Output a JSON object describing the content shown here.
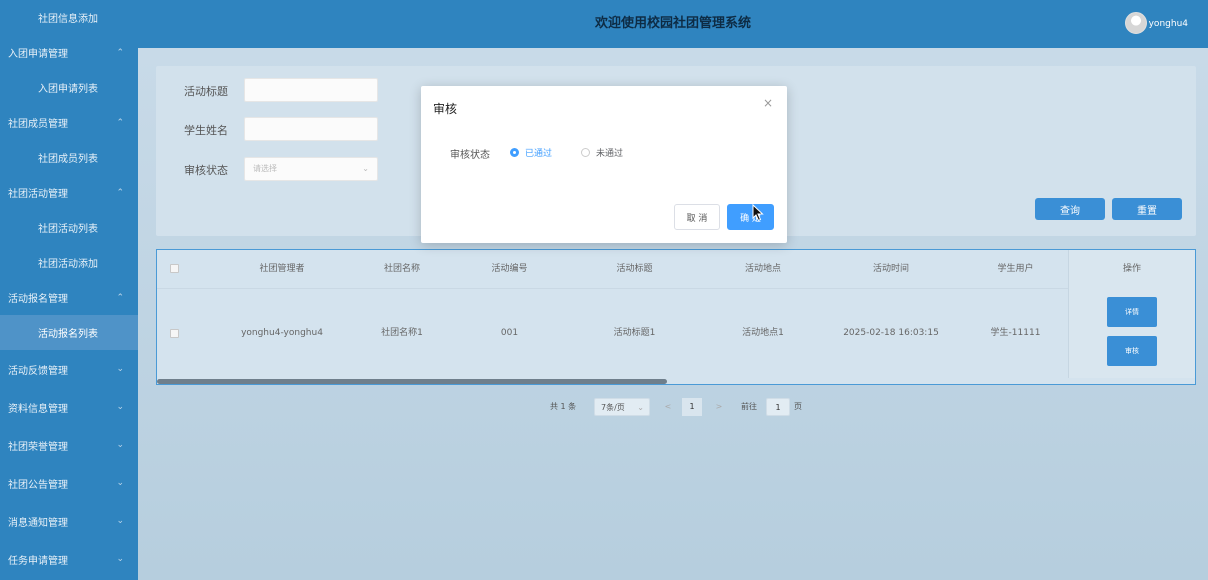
{
  "sidebar": {
    "items": [
      {
        "label": "社团信息添加",
        "sub": true
      },
      {
        "label": "入团申请管理",
        "sub": false,
        "chevron": "up"
      },
      {
        "label": "入团申请列表",
        "sub": true
      },
      {
        "label": "社团成员管理",
        "sub": false,
        "chevron": "up"
      },
      {
        "label": "社团成员列表",
        "sub": true
      },
      {
        "label": "社团活动管理",
        "sub": false,
        "chevron": "up"
      },
      {
        "label": "社团活动列表",
        "sub": true
      },
      {
        "label": "社团活动添加",
        "sub": true
      },
      {
        "label": "活动报名管理",
        "sub": false,
        "chevron": "up"
      },
      {
        "label": "活动报名列表",
        "sub": true,
        "active": true
      },
      {
        "label": "活动反馈管理",
        "sub": false,
        "chevron": "down"
      },
      {
        "label": "资料信息管理",
        "sub": false,
        "chevron": "down"
      },
      {
        "label": "社团荣誉管理",
        "sub": false,
        "chevron": "down"
      },
      {
        "label": "社团公告管理",
        "sub": false,
        "chevron": "down"
      },
      {
        "label": "消息通知管理",
        "sub": false,
        "chevron": "down"
      },
      {
        "label": "任务申请管理",
        "sub": false,
        "chevron": "down"
      }
    ]
  },
  "header": {
    "title": "欢迎使用校园社团管理系统",
    "username": "yonghu4"
  },
  "search": {
    "activity_title_label": "活动标题",
    "student_name_label": "学生姓名",
    "review_status_label": "审核状态",
    "review_status_placeholder": "请选择",
    "query_button": "查询",
    "reset_button": "重置"
  },
  "table": {
    "columns": [
      "社团管理者",
      "社团名称",
      "活动编号",
      "活动标题",
      "活动地点",
      "活动时间",
      "学生用户",
      "操作"
    ],
    "rows": [
      {
        "manager": "yonghu4-yonghu4",
        "club_name": "社团名称1",
        "activity_no": "001",
        "activity_title": "活动标题1",
        "location": "活动地点1",
        "time": "2025-02-18 16:03:15",
        "student": "学生-11111",
        "detail_button": "详情",
        "review_button": "审核"
      }
    ]
  },
  "pagination": {
    "total": "共 1 条",
    "page_size": "7条/页",
    "prev": "<",
    "current": "1",
    "next": ">",
    "goto_label": "前往",
    "goto_value": "1",
    "page_suffix": "页"
  },
  "modal": {
    "title": "审核",
    "close": "×",
    "field_label": "审核状态",
    "options": [
      {
        "label": "已通过",
        "checked": true
      },
      {
        "label": "未通过",
        "checked": false
      }
    ],
    "cancel_button": "取 消",
    "confirm_button": "确 定"
  },
  "colors": {
    "sidebar_bg": "#2f84bf",
    "primary": "#409eff",
    "button_blue": "#3a8fd6"
  }
}
